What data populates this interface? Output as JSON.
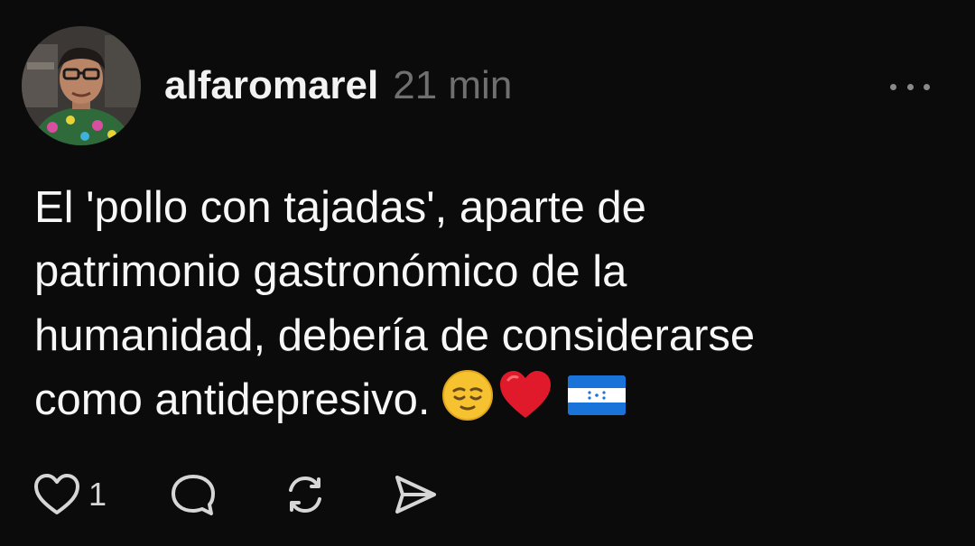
{
  "post": {
    "username": "alfaromarel",
    "timestamp": "21 min",
    "text_lines": [
      "El 'pollo con tajadas', aparte de",
      "patrimonio gastronómico de la",
      "humanidad, debería de considerarse",
      "como antidepresivo."
    ],
    "emojis": [
      "relieved-face-emoji",
      "red-heart-emoji",
      "honduras-flag-emoji"
    ],
    "like_count": "1"
  },
  "icons": {
    "more": "more-dots-icon",
    "like": "heart-icon",
    "reply": "comment-bubble-icon",
    "repost": "repost-icon",
    "share": "send-icon"
  },
  "colors": {
    "background": "#0b0b0b",
    "text": "#f5f5f5",
    "muted": "#6f6f6f",
    "heart_emoji": "#e0192b",
    "flag_blue": "#1a73d9"
  }
}
